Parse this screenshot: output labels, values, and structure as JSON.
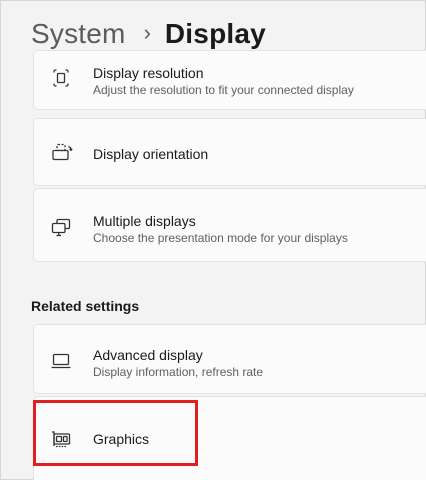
{
  "breadcrumb": {
    "parent": "System",
    "separator": "›",
    "current": "Display"
  },
  "settings_cards": [
    {
      "icon": "display-resolution-icon",
      "title": "Display resolution",
      "subtitle": "Adjust the resolution to fit your connected display"
    },
    {
      "icon": "display-orientation-icon",
      "title": "Display orientation",
      "subtitle": ""
    },
    {
      "icon": "multiple-displays-icon",
      "title": "Multiple displays",
      "subtitle": "Choose the presentation mode for your displays"
    }
  ],
  "related_settings": {
    "heading": "Related settings",
    "items": [
      {
        "icon": "laptop-icon",
        "title": "Advanced display",
        "subtitle": "Display information, refresh rate"
      },
      {
        "icon": "graphics-card-icon",
        "title": "Graphics",
        "subtitle": "",
        "highlighted": true
      }
    ]
  },
  "colors": {
    "page_background": "#f3f3f3",
    "card_background": "#fbfbfb",
    "highlight": "#e02020"
  }
}
